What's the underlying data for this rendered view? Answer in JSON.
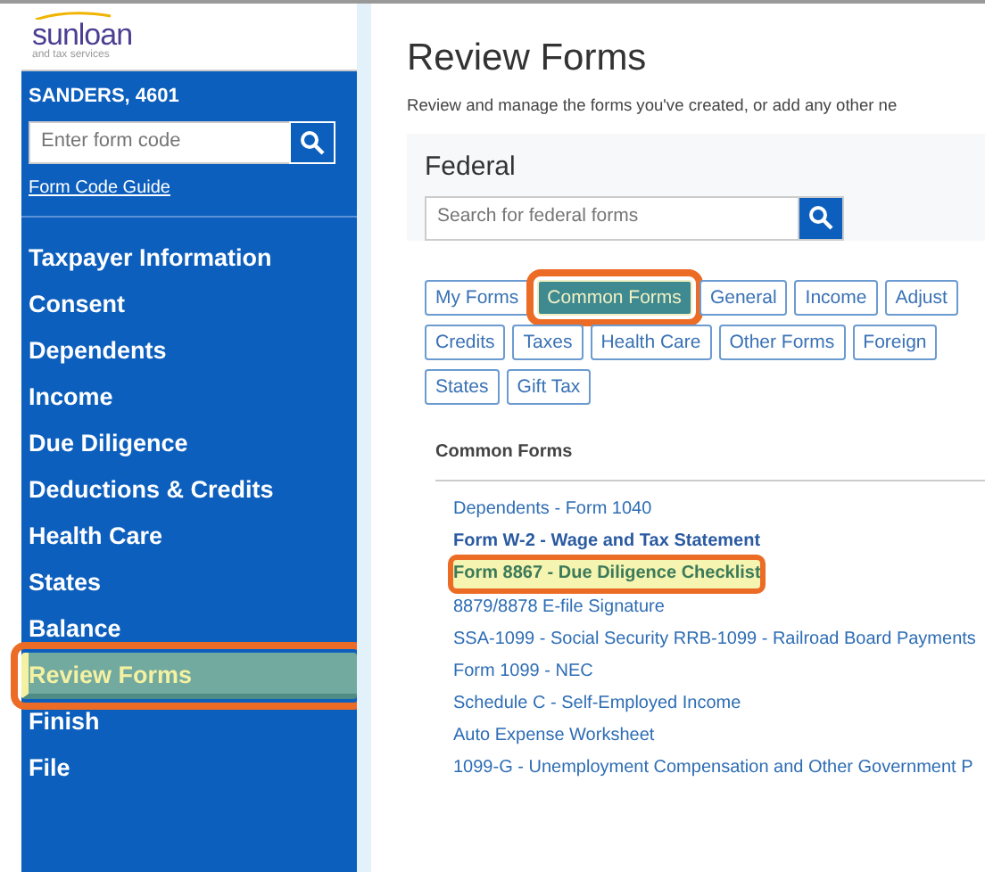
{
  "logo": {
    "name": "sunloan",
    "tagline": "and tax services"
  },
  "sidebar": {
    "client": "SANDERS, 4601",
    "form_code": {
      "placeholder": "Enter form code"
    },
    "guide_link": "Form Code Guide",
    "items": [
      {
        "label": "Taxpayer Information",
        "selected": false,
        "highlighted": false
      },
      {
        "label": "Consent",
        "selected": false,
        "highlighted": false
      },
      {
        "label": "Dependents",
        "selected": false,
        "highlighted": false
      },
      {
        "label": "Income",
        "selected": false,
        "highlighted": false
      },
      {
        "label": "Due Diligence",
        "selected": false,
        "highlighted": false
      },
      {
        "label": "Deductions & Credits",
        "selected": false,
        "highlighted": false
      },
      {
        "label": "Health Care",
        "selected": false,
        "highlighted": false
      },
      {
        "label": "States",
        "selected": false,
        "highlighted": false
      },
      {
        "label": "Balance",
        "selected": false,
        "highlighted": false
      },
      {
        "label": "Review Forms",
        "selected": true,
        "highlighted": true
      },
      {
        "label": "Finish",
        "selected": false,
        "highlighted": false
      },
      {
        "label": "File",
        "selected": false,
        "highlighted": false
      }
    ]
  },
  "main": {
    "title": "Review Forms",
    "description": "Review and manage the forms you've created, or add any other ne",
    "federal": {
      "title": "Federal",
      "search": {
        "placeholder": "Search for federal forms"
      },
      "tab_rows": [
        [
          {
            "label": "My Forms",
            "selected": false,
            "highlighted": false
          },
          {
            "label": "Common Forms",
            "selected": true,
            "highlighted": true
          },
          {
            "label": "General",
            "selected": false,
            "highlighted": false
          },
          {
            "label": "Income",
            "selected": false,
            "highlighted": false
          },
          {
            "label": "Adjust",
            "selected": false,
            "highlighted": false
          }
        ],
        [
          {
            "label": "Credits",
            "selected": false,
            "highlighted": false
          },
          {
            "label": "Taxes",
            "selected": false,
            "highlighted": false
          },
          {
            "label": "Health Care",
            "selected": false,
            "highlighted": false
          },
          {
            "label": "Other Forms",
            "selected": false,
            "highlighted": false
          },
          {
            "label": "Foreign",
            "selected": false,
            "highlighted": false
          }
        ],
        [
          {
            "label": "States",
            "selected": false,
            "highlighted": false
          },
          {
            "label": "Gift Tax",
            "selected": false,
            "highlighted": false
          }
        ]
      ],
      "list_title": "Common Forms",
      "forms": [
        {
          "label": "Dependents - Form 1040",
          "bold": false,
          "highlighted": false
        },
        {
          "label": "Form W-2 - Wage and Tax Statement",
          "bold": true,
          "highlighted": false
        },
        {
          "label": "Form 8867 - Due Diligence Checklist",
          "bold": true,
          "highlighted": true
        },
        {
          "label": "8879/8878 E-file Signature",
          "bold": false,
          "highlighted": false
        },
        {
          "label": "SSA-1099 - Social Security RRB-1099 - Railroad Board Payments",
          "bold": false,
          "highlighted": false
        },
        {
          "label": "Form 1099 - NEC",
          "bold": false,
          "highlighted": false
        },
        {
          "label": "Schedule C - Self-Employed Income",
          "bold": false,
          "highlighted": false
        },
        {
          "label": "Auto Expense Worksheet",
          "bold": false,
          "highlighted": false
        },
        {
          "label": "1099-G - Unemployment Compensation and Other Government P",
          "bold": false,
          "highlighted": false
        }
      ]
    }
  }
}
